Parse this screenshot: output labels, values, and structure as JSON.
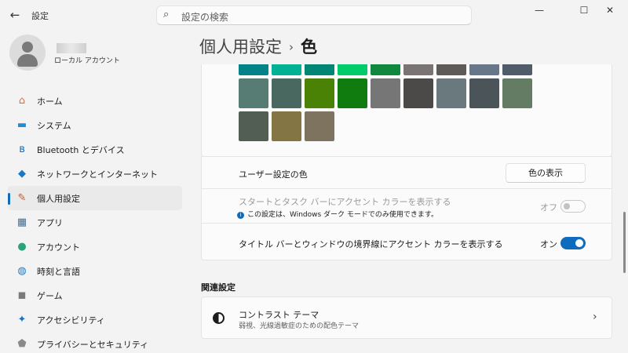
{
  "window": {
    "app_title": "設定",
    "back_icon": "arrow-left-icon"
  },
  "search": {
    "placeholder": "設定の検索"
  },
  "user": {
    "account_type": "ローカル アカウント"
  },
  "nav": {
    "items": [
      {
        "label": "ホーム",
        "icon": "home-icon",
        "color": "#e06c3a",
        "glyph": "⌂"
      },
      {
        "label": "システム",
        "icon": "monitor-icon",
        "color": "#1e8fd6",
        "glyph": "▬"
      },
      {
        "label": "Bluetooth とデバイス",
        "icon": "bluetooth-icon",
        "color": "#0f6cbd",
        "glyph": "ʙ"
      },
      {
        "label": "ネットワークとインターネット",
        "icon": "wifi-icon",
        "color": "#1877c9",
        "glyph": "◆"
      },
      {
        "label": "個人用設定",
        "icon": "brush-icon",
        "color": "#b0623a",
        "glyph": "✎",
        "active": true
      },
      {
        "label": "アプリ",
        "icon": "apps-icon",
        "color": "#4a6a8a",
        "glyph": "▦"
      },
      {
        "label": "アカウント",
        "icon": "person-icon",
        "color": "#2aa37a",
        "glyph": "●"
      },
      {
        "label": "時刻と言語",
        "icon": "globe-clock-icon",
        "color": "#1e7bc8",
        "glyph": "◍"
      },
      {
        "label": "ゲーム",
        "icon": "gamepad-icon",
        "color": "#7a7a7a",
        "glyph": "◼"
      },
      {
        "label": "アクセシビリティ",
        "icon": "accessibility-icon",
        "color": "#1a73c8",
        "glyph": "✦"
      },
      {
        "label": "プライバシーとセキュリティ",
        "icon": "shield-icon",
        "color": "#8a8a8a",
        "glyph": "⬟"
      }
    ]
  },
  "header": {
    "crumb": "個人用設定",
    "separator": "›",
    "current": "色"
  },
  "palette": {
    "row_top": [
      "#038387",
      "#00b294",
      "#018574",
      "#00cc6a",
      "#10893e",
      "#7a7574",
      "#5d5a58",
      "#68768a",
      "#515c6b"
    ],
    "row_mid": [
      "#567c73",
      "#486860",
      "#498205",
      "#107c10",
      "#767676",
      "#4c4a48",
      "#69797e",
      "#4a5459",
      "#647c64"
    ],
    "row_bottom": [
      "#525e54",
      "#847545",
      "#7e735f"
    ]
  },
  "custom_color": {
    "label": "ユーザー設定の色",
    "button": "色の表示"
  },
  "start_taskbar": {
    "label": "スタートとタスク バーにアクセント カラーを表示する",
    "note": "この設定は、Windows ダーク モードでのみ使用できます。",
    "state": "オフ"
  },
  "title_bar": {
    "label": "タイトル バーとウィンドウの境界線にアクセント カラーを表示する",
    "state": "オン"
  },
  "related": {
    "heading": "関連設定",
    "contrast_title": "コントラスト テーマ",
    "contrast_desc": "弱視、光線過敏症のための配色テーマ"
  },
  "colors": {
    "accent": "#0f6cbd"
  }
}
